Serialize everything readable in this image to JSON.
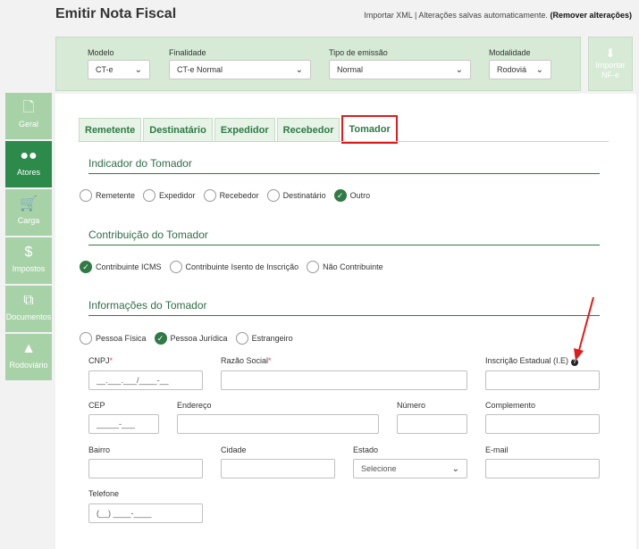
{
  "header": {
    "title": "Emitir Nota Fiscal",
    "import_link": "Importar XML",
    "separator": "|",
    "status_text": "Alterações salvas automaticamente.",
    "remove_link": "(Remover alterações)"
  },
  "topbar": {
    "modelo": {
      "label": "Modelo",
      "value": "CT-e"
    },
    "finalidade": {
      "label": "Finalidade",
      "value": "CT-e Normal"
    },
    "tipo_emissao": {
      "label": "Tipo de emissão",
      "value": "Normal"
    },
    "modalidade": {
      "label": "Modalidade",
      "value": "Rodoviá"
    },
    "import_button": {
      "line1": "Importar",
      "line2": "NF-e",
      "icon": "download-icon"
    }
  },
  "sidebar": {
    "items": [
      {
        "label": "Geral",
        "icon": "document-icon",
        "active": false
      },
      {
        "label": "Atores",
        "icon": "users-icon",
        "active": true
      },
      {
        "label": "Carga",
        "icon": "cart-icon",
        "active": false
      },
      {
        "label": "Impostos",
        "icon": "dollar-icon",
        "active": false
      },
      {
        "label": "Documentos",
        "icon": "copy-icon",
        "active": false
      },
      {
        "label": "Rodoviário",
        "icon": "road-icon",
        "active": false
      }
    ]
  },
  "tabs": [
    {
      "label": "Remetente",
      "active": false
    },
    {
      "label": "Destinatário",
      "active": false
    },
    {
      "label": "Expedidor",
      "active": false
    },
    {
      "label": "Recebedor",
      "active": false
    },
    {
      "label": "Tomador",
      "active": true
    }
  ],
  "indicador": {
    "title": "Indicador do Tomador",
    "options": [
      {
        "label": "Remetente",
        "checked": false
      },
      {
        "label": "Expedidor",
        "checked": false
      },
      {
        "label": "Recebedor",
        "checked": false
      },
      {
        "label": "Destinatário",
        "checked": false
      },
      {
        "label": "Outro",
        "checked": true
      }
    ]
  },
  "contribuicao": {
    "title": "Contribuição do Tomador",
    "options": [
      {
        "label": "Contribuinte ICMS",
        "checked": true
      },
      {
        "label": "Contribuinte Isento de Inscrição",
        "checked": false
      },
      {
        "label": "Não Contribuinte",
        "checked": false
      }
    ]
  },
  "informacoes": {
    "title": "Informações do Tomador",
    "pessoa_options": [
      {
        "label": "Pessoa Física",
        "checked": false
      },
      {
        "label": "Pessoa Jurídica",
        "checked": true
      },
      {
        "label": "Estrangeiro",
        "checked": false
      }
    ],
    "fields": {
      "cnpj": {
        "label": "CNPJ",
        "required_mark": "*",
        "placeholder": "__.___.___/____-__"
      },
      "razao_social": {
        "label": "Razão Social",
        "required_mark": "*"
      },
      "ie": {
        "label": "Inscrição Estadual (I.E)",
        "help": "?"
      },
      "cep": {
        "label": "CEP",
        "placeholder": "_____-___"
      },
      "endereco": {
        "label": "Endereço"
      },
      "numero": {
        "label": "Número"
      },
      "complemento": {
        "label": "Complemento"
      },
      "bairro": {
        "label": "Bairro"
      },
      "cidade": {
        "label": "Cidade"
      },
      "estado": {
        "label": "Estado",
        "value": "Selecione"
      },
      "email": {
        "label": "E-mail"
      },
      "telefone": {
        "label": "Telefone",
        "placeholder": "(__) ____-____"
      }
    }
  },
  "colors": {
    "accent": "#2c8a4b",
    "highlight": "#e01b1b"
  }
}
